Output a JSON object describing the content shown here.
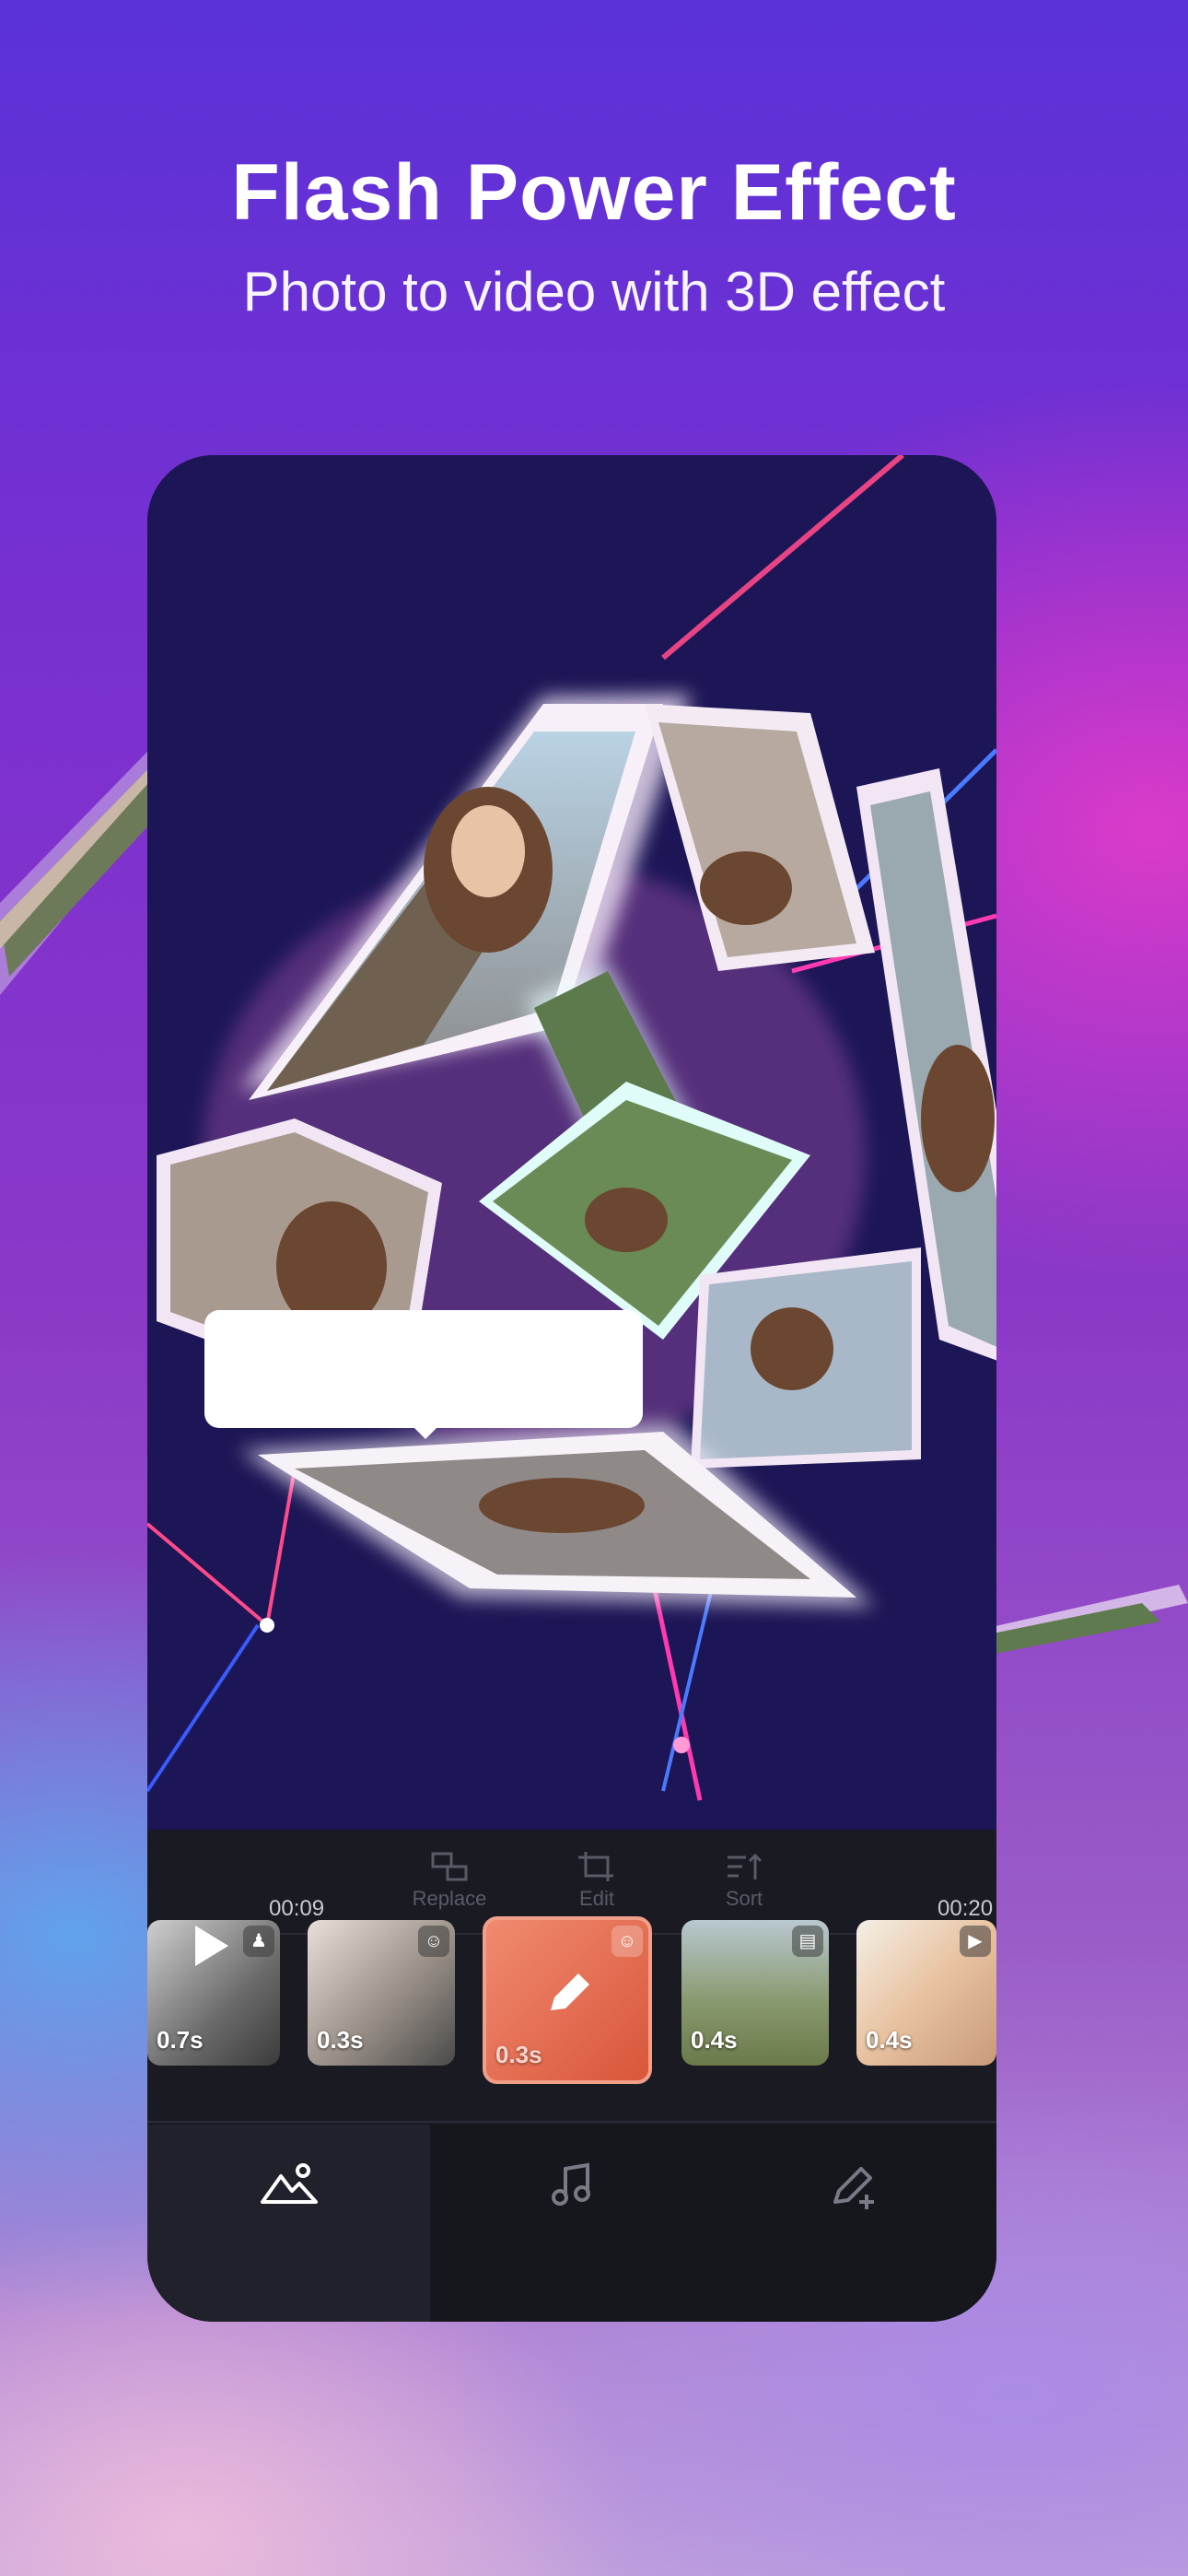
{
  "header": {
    "title": "Flash Power Effect",
    "subtitle": "Photo to video with 3D effect"
  },
  "toolbar": {
    "tools": [
      {
        "label": "Replace",
        "icon": "replace-icon"
      },
      {
        "label": "Edit",
        "icon": "crop-icon"
      },
      {
        "label": "Sort",
        "icon": "sort-icon"
      }
    ]
  },
  "timeline": {
    "start_time": "00:09",
    "end_time": "00:20",
    "clips": [
      {
        "duration": "0.7s",
        "badge": "person-icon"
      },
      {
        "duration": "0.3s",
        "badge": "face-icon"
      },
      {
        "duration": "0.3s",
        "badge": "face-icon",
        "selected": true
      },
      {
        "duration": "0.4s",
        "badge": "image-icon"
      },
      {
        "duration": "0.4s",
        "badge": "video-icon"
      }
    ]
  },
  "tabs": [
    {
      "name": "photos",
      "icon": "landscape-icon",
      "active": true
    },
    {
      "name": "music",
      "icon": "music-note-icon",
      "active": false
    },
    {
      "name": "edit",
      "icon": "pencil-plus-icon",
      "active": false
    }
  ],
  "colors": {
    "selected_clip": "#e46a4e",
    "panel_bg": "#1a1a22",
    "accent_glow": "#ff7ae8"
  }
}
